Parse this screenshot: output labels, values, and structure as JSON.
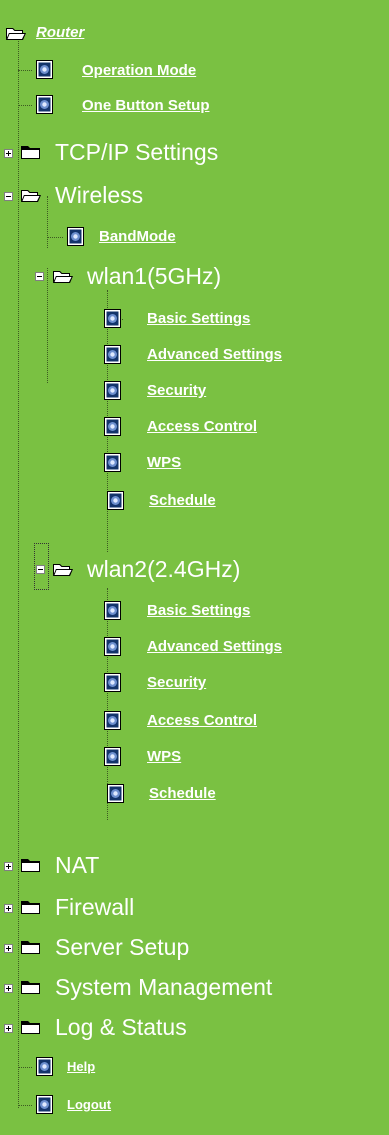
{
  "tree": {
    "root": {
      "label": "Router",
      "icon": "open-folder-icon"
    },
    "items": [
      {
        "label": "Operation Mode",
        "icon": "document-icon",
        "kind": "link"
      },
      {
        "label": "One Button Setup",
        "icon": "document-icon",
        "kind": "link"
      },
      {
        "label": "TCP/IP Settings",
        "icon": "folder-icon",
        "kind": "folder",
        "state": "collapsed"
      },
      {
        "label": "Wireless",
        "icon": "open-folder-icon",
        "kind": "folder",
        "state": "expanded"
      },
      {
        "label": "BandMode",
        "icon": "document-icon",
        "kind": "link"
      },
      {
        "label": "wlan1(5GHz)",
        "icon": "open-folder-icon",
        "kind": "folder",
        "state": "expanded"
      },
      {
        "label": "Basic Settings",
        "icon": "document-icon",
        "kind": "link"
      },
      {
        "label": "Advanced Settings",
        "icon": "document-icon",
        "kind": "link"
      },
      {
        "label": "Security",
        "icon": "document-icon",
        "kind": "link"
      },
      {
        "label": "Access Control",
        "icon": "document-icon",
        "kind": "link"
      },
      {
        "label": "WPS",
        "icon": "document-icon",
        "kind": "link"
      },
      {
        "label": "Schedule",
        "icon": "document-icon",
        "kind": "link"
      },
      {
        "label": "wlan2(2.4GHz)",
        "icon": "open-folder-icon",
        "kind": "folder",
        "state": "expanded"
      },
      {
        "label": "Basic Settings",
        "icon": "document-icon",
        "kind": "link"
      },
      {
        "label": "Advanced Settings",
        "icon": "document-icon",
        "kind": "link"
      },
      {
        "label": "Security",
        "icon": "document-icon",
        "kind": "link"
      },
      {
        "label": "Access Control",
        "icon": "document-icon",
        "kind": "link"
      },
      {
        "label": "WPS",
        "icon": "document-icon",
        "kind": "link"
      },
      {
        "label": "Schedule",
        "icon": "document-icon",
        "kind": "link"
      },
      {
        "label": "NAT",
        "icon": "folder-icon",
        "kind": "folder",
        "state": "collapsed"
      },
      {
        "label": "Firewall",
        "icon": "folder-icon",
        "kind": "folder",
        "state": "collapsed"
      },
      {
        "label": "Server Setup",
        "icon": "folder-icon",
        "kind": "folder",
        "state": "collapsed"
      },
      {
        "label": "System Management",
        "icon": "folder-icon",
        "kind": "folder",
        "state": "collapsed"
      },
      {
        "label": "Log & Status",
        "icon": "folder-icon",
        "kind": "folder",
        "state": "collapsed"
      },
      {
        "label": "Help",
        "icon": "document-icon",
        "kind": "link"
      },
      {
        "label": "Logout",
        "icon": "document-icon",
        "kind": "link"
      }
    ]
  },
  "colors": {
    "background": "#7ac142",
    "text": "#ffffff",
    "tree_lines": "#3d5b22"
  }
}
